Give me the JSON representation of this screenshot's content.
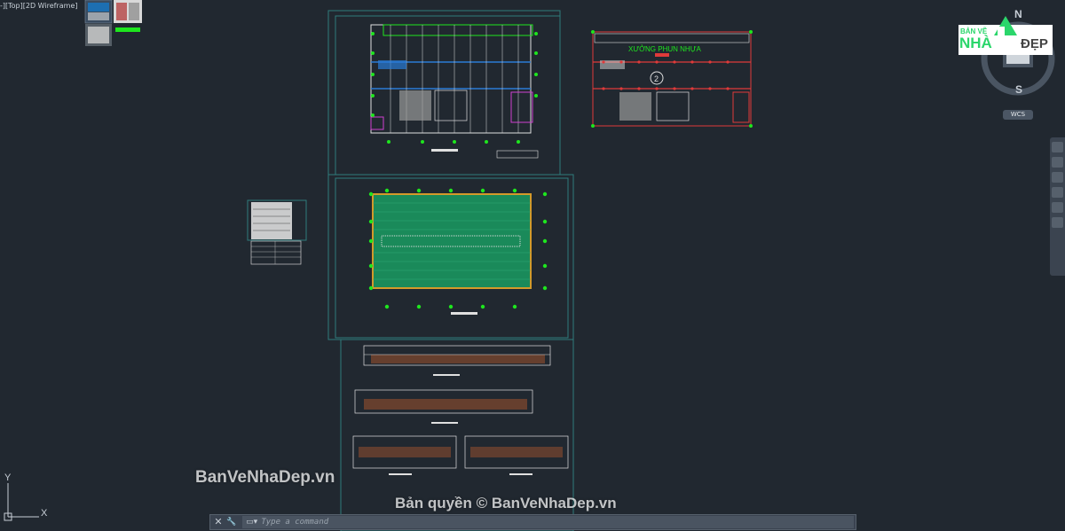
{
  "viewport": {
    "label": "-][Top][2D Wireframe]"
  },
  "drawing": {
    "plan_title": "XƯỞNG PHUN NHỰA",
    "plan_badge": "2"
  },
  "viewcube": {
    "north": "N",
    "south": "S",
    "wcs_label": "WCS"
  },
  "logo": {
    "line1": "BẢN VẼ",
    "line2": "NHÀ",
    "line3": "ĐẸP"
  },
  "command_line": {
    "placeholder": "Type a command",
    "close_glyph": "✕",
    "settings_glyph": "🔧"
  },
  "ucs": {
    "x_label": "X",
    "y_label": "Y"
  },
  "watermarks": {
    "site": "BanVeNhaDep.vn",
    "copyright": "Bản quyền © BanVeNhaDep.vn"
  },
  "colors": {
    "background": "#212830",
    "frame": "#2f7c7c",
    "roof_fill": "#1a8a5a",
    "roof_border": "#d39a2a",
    "plan_lines": "#e0e0e0",
    "column_red": "#e03a3a",
    "accent_green": "#1ee61e",
    "logo_green": "#2bd66b"
  }
}
